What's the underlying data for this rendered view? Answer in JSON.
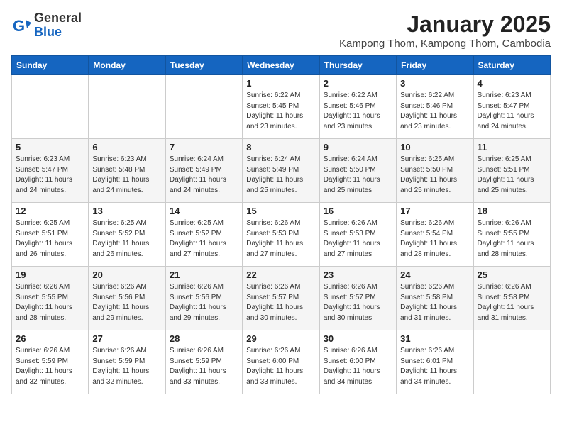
{
  "header": {
    "logo_general": "General",
    "logo_blue": "Blue",
    "month_title": "January 2025",
    "subtitle": "Kampong Thom, Kampong Thom, Cambodia"
  },
  "days_of_week": [
    "Sunday",
    "Monday",
    "Tuesday",
    "Wednesday",
    "Thursday",
    "Friday",
    "Saturday"
  ],
  "weeks": [
    [
      {
        "day": "",
        "info": ""
      },
      {
        "day": "",
        "info": ""
      },
      {
        "day": "",
        "info": ""
      },
      {
        "day": "1",
        "info": "Sunrise: 6:22 AM\nSunset: 5:45 PM\nDaylight: 11 hours and 23 minutes."
      },
      {
        "day": "2",
        "info": "Sunrise: 6:22 AM\nSunset: 5:46 PM\nDaylight: 11 hours and 23 minutes."
      },
      {
        "day": "3",
        "info": "Sunrise: 6:22 AM\nSunset: 5:46 PM\nDaylight: 11 hours and 23 minutes."
      },
      {
        "day": "4",
        "info": "Sunrise: 6:23 AM\nSunset: 5:47 PM\nDaylight: 11 hours and 24 minutes."
      }
    ],
    [
      {
        "day": "5",
        "info": "Sunrise: 6:23 AM\nSunset: 5:47 PM\nDaylight: 11 hours and 24 minutes."
      },
      {
        "day": "6",
        "info": "Sunrise: 6:23 AM\nSunset: 5:48 PM\nDaylight: 11 hours and 24 minutes."
      },
      {
        "day": "7",
        "info": "Sunrise: 6:24 AM\nSunset: 5:49 PM\nDaylight: 11 hours and 24 minutes."
      },
      {
        "day": "8",
        "info": "Sunrise: 6:24 AM\nSunset: 5:49 PM\nDaylight: 11 hours and 25 minutes."
      },
      {
        "day": "9",
        "info": "Sunrise: 6:24 AM\nSunset: 5:50 PM\nDaylight: 11 hours and 25 minutes."
      },
      {
        "day": "10",
        "info": "Sunrise: 6:25 AM\nSunset: 5:50 PM\nDaylight: 11 hours and 25 minutes."
      },
      {
        "day": "11",
        "info": "Sunrise: 6:25 AM\nSunset: 5:51 PM\nDaylight: 11 hours and 25 minutes."
      }
    ],
    [
      {
        "day": "12",
        "info": "Sunrise: 6:25 AM\nSunset: 5:51 PM\nDaylight: 11 hours and 26 minutes."
      },
      {
        "day": "13",
        "info": "Sunrise: 6:25 AM\nSunset: 5:52 PM\nDaylight: 11 hours and 26 minutes."
      },
      {
        "day": "14",
        "info": "Sunrise: 6:25 AM\nSunset: 5:52 PM\nDaylight: 11 hours and 27 minutes."
      },
      {
        "day": "15",
        "info": "Sunrise: 6:26 AM\nSunset: 5:53 PM\nDaylight: 11 hours and 27 minutes."
      },
      {
        "day": "16",
        "info": "Sunrise: 6:26 AM\nSunset: 5:53 PM\nDaylight: 11 hours and 27 minutes."
      },
      {
        "day": "17",
        "info": "Sunrise: 6:26 AM\nSunset: 5:54 PM\nDaylight: 11 hours and 28 minutes."
      },
      {
        "day": "18",
        "info": "Sunrise: 6:26 AM\nSunset: 5:55 PM\nDaylight: 11 hours and 28 minutes."
      }
    ],
    [
      {
        "day": "19",
        "info": "Sunrise: 6:26 AM\nSunset: 5:55 PM\nDaylight: 11 hours and 28 minutes."
      },
      {
        "day": "20",
        "info": "Sunrise: 6:26 AM\nSunset: 5:56 PM\nDaylight: 11 hours and 29 minutes."
      },
      {
        "day": "21",
        "info": "Sunrise: 6:26 AM\nSunset: 5:56 PM\nDaylight: 11 hours and 29 minutes."
      },
      {
        "day": "22",
        "info": "Sunrise: 6:26 AM\nSunset: 5:57 PM\nDaylight: 11 hours and 30 minutes."
      },
      {
        "day": "23",
        "info": "Sunrise: 6:26 AM\nSunset: 5:57 PM\nDaylight: 11 hours and 30 minutes."
      },
      {
        "day": "24",
        "info": "Sunrise: 6:26 AM\nSunset: 5:58 PM\nDaylight: 11 hours and 31 minutes."
      },
      {
        "day": "25",
        "info": "Sunrise: 6:26 AM\nSunset: 5:58 PM\nDaylight: 11 hours and 31 minutes."
      }
    ],
    [
      {
        "day": "26",
        "info": "Sunrise: 6:26 AM\nSunset: 5:59 PM\nDaylight: 11 hours and 32 minutes."
      },
      {
        "day": "27",
        "info": "Sunrise: 6:26 AM\nSunset: 5:59 PM\nDaylight: 11 hours and 32 minutes."
      },
      {
        "day": "28",
        "info": "Sunrise: 6:26 AM\nSunset: 5:59 PM\nDaylight: 11 hours and 33 minutes."
      },
      {
        "day": "29",
        "info": "Sunrise: 6:26 AM\nSunset: 6:00 PM\nDaylight: 11 hours and 33 minutes."
      },
      {
        "day": "30",
        "info": "Sunrise: 6:26 AM\nSunset: 6:00 PM\nDaylight: 11 hours and 34 minutes."
      },
      {
        "day": "31",
        "info": "Sunrise: 6:26 AM\nSunset: 6:01 PM\nDaylight: 11 hours and 34 minutes."
      },
      {
        "day": "",
        "info": ""
      }
    ]
  ]
}
